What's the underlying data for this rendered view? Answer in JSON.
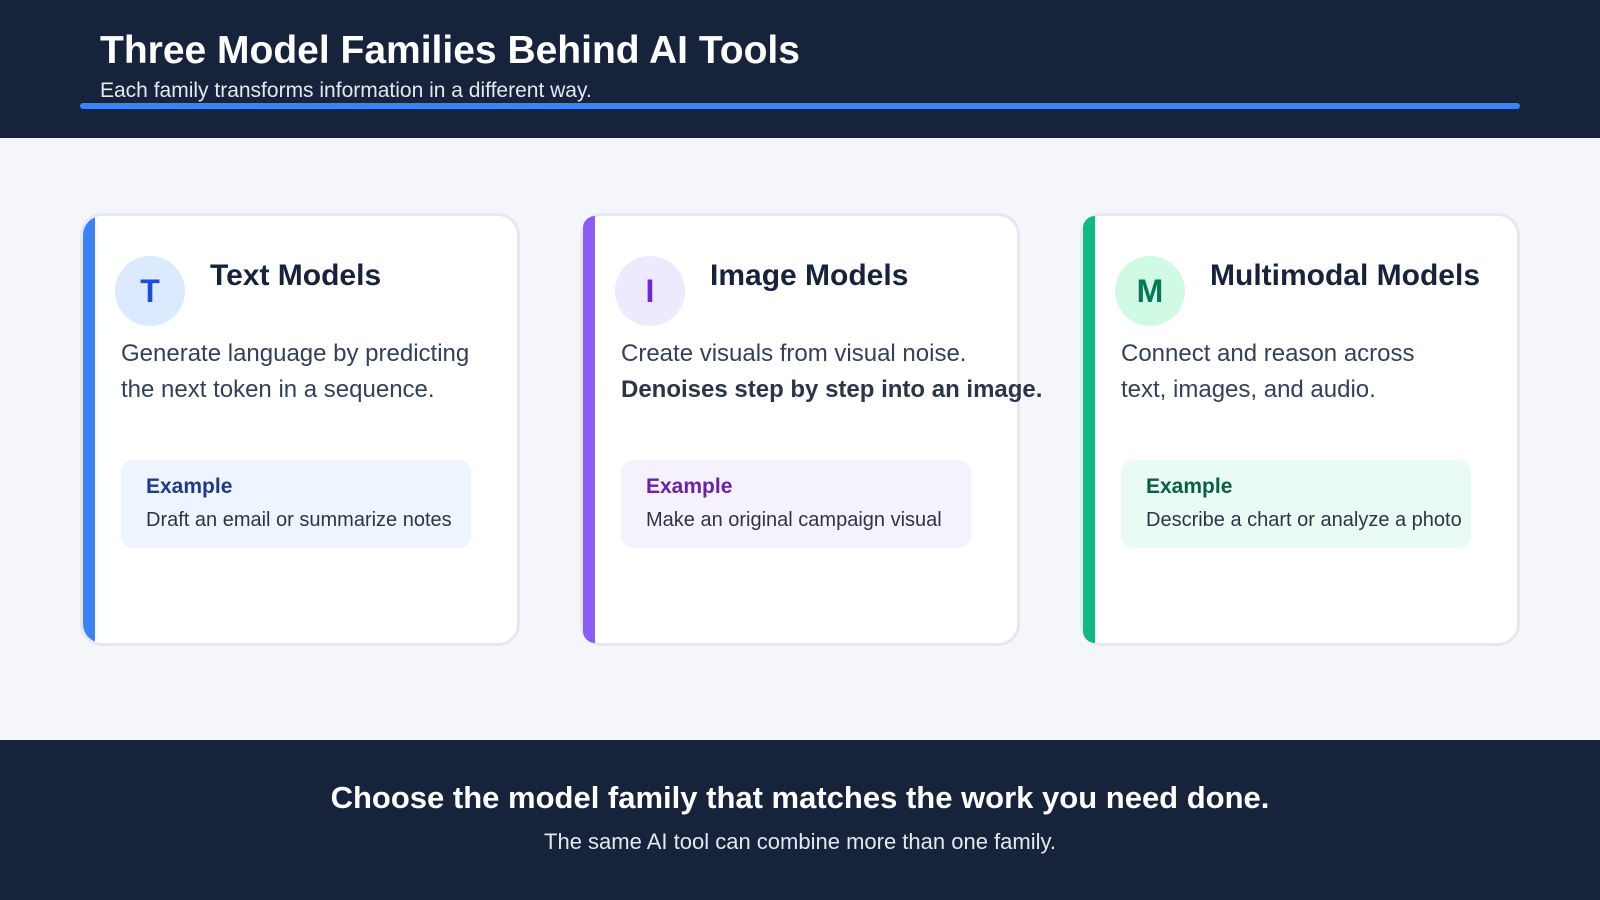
{
  "header": {
    "title": "Three Model Families Behind AI Tools",
    "subtitle": "Each family transforms information in a different way.",
    "rule_color": "#3b82f6"
  },
  "cards": [
    {
      "icon_letter": "T",
      "title": "Text Models",
      "description_lines": [
        "Generate language by predicting",
        "the next token in a sequence."
      ],
      "example_label": "Example",
      "example_text": "Draft an email or summarize notes",
      "accent_color": "#3b82f6",
      "icon_bg": "#dbeafe",
      "icon_color": "#1d4ed8",
      "example_bg": "#eff5ff",
      "example_label_color": "#1e3a8a"
    },
    {
      "icon_letter": "I",
      "title": "Image Models",
      "description_lines": [
        "Create visuals from visual noise.",
        "Denoises step by step into an image."
      ],
      "example_label": "Example",
      "example_text": "Make an original campaign visual",
      "accent_color": "#8b5cf6",
      "icon_bg": "#ede9fe",
      "icon_color": "#6d28d9",
      "example_bg": "#f5f2fe",
      "example_label_color": "#6b21a8"
    },
    {
      "icon_letter": "M",
      "title": "Multimodal Models",
      "description_lines": [
        "Connect and reason across",
        "text, images, and audio."
      ],
      "example_label": "Example",
      "example_text": "Describe a chart or analyze a photo",
      "accent_color": "#10b981",
      "icon_bg": "#d1fae5",
      "icon_color": "#047857",
      "example_bg": "#e9fbf3",
      "example_label_color": "#065f46"
    }
  ],
  "footer": {
    "title": "Choose the model family that matches the work you need done.",
    "subtitle": "The same AI tool can combine more than one family."
  }
}
